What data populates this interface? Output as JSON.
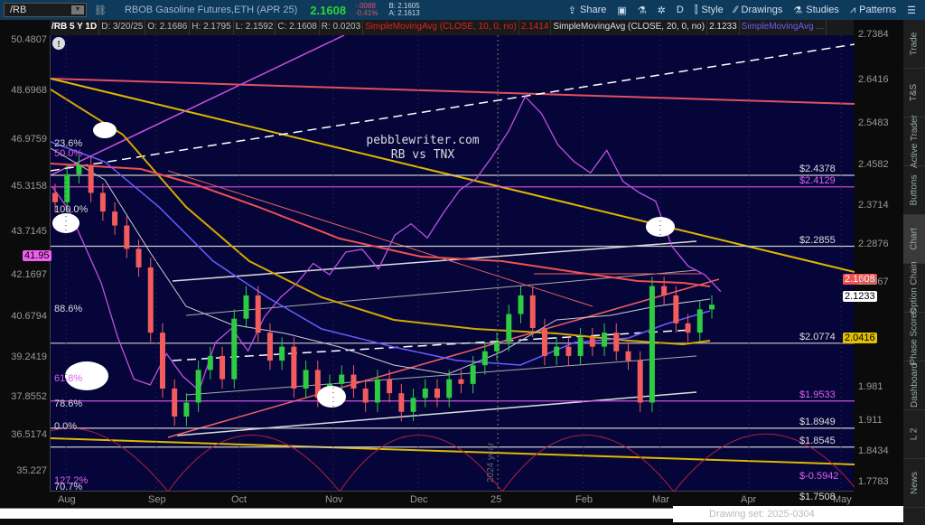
{
  "header": {
    "symbol": "/RB",
    "title": "RBOB Gasoline Futures,ETH (APR 25)",
    "last": "2.1608",
    "change": "-.0088",
    "change_pct": "-0.41%",
    "bid": "B: 2.1605",
    "ask": "A: 2.1613",
    "buttons": [
      "Share",
      "D",
      "Style",
      "Drawings",
      "Studies",
      "Patterns"
    ]
  },
  "info": {
    "label": "/RB 5 Y 1D",
    "date": "D: 3/20/25",
    "open": "O: 2.1686",
    "high": "H: 2.1795",
    "low": "L: 2.1592",
    "close": "C: 2.1608",
    "range": "R: 0.0203",
    "sma10": "SimpleMovingAvg (CLOSE, 10, 0, no)",
    "sma10_val": "2.1414",
    "sma20": "SimpleMovingAvg (CLOSE, 20, 0, no)",
    "sma20_val": "2.1233",
    "sma_other": "SimpleMovingAvg ..."
  },
  "sidebar": [
    "Trade",
    "T&S",
    "Active Trader",
    "Buttons",
    "Chart",
    "Option Chain",
    "Phase Scores",
    "Dashboard",
    "L 2",
    "News"
  ],
  "status": "Drawing set: 2025-0304",
  "colors": {
    "bg": "#05053a",
    "up": "#2ecc40",
    "down": "#f25c5c",
    "tnx": "#c050e0",
    "sma_red": "#e03030",
    "sma_gold": "#d4a800"
  },
  "chart_data": {
    "type": "candlestick",
    "title": "pebblewriter.com",
    "subtitle": "RB vs TNX",
    "x_ticks": [
      "Aug",
      "Sep",
      "Oct",
      "Nov",
      "Dec",
      "25",
      "Feb",
      "Mar",
      "Apr",
      "May"
    ],
    "divider_label": "2024 year",
    "right_axis": {
      "ticks": [
        "2.7384",
        "2.6416",
        "2.5483",
        "2.4582",
        "2.3714",
        "2.2876",
        "2.2067",
        "1.981",
        "1.911",
        "1.8434",
        "1.7783"
      ],
      "range": [
        1.7783,
        2.7384
      ]
    },
    "left_axis": {
      "ticks": [
        "50.4807",
        "48.6968",
        "46.9759",
        "45.3158",
        "43.7145",
        "42.1697",
        "40.6794",
        "39.2419",
        "37.8552",
        "36.5174",
        "35.227"
      ],
      "range": [
        35.227,
        50.4807
      ]
    },
    "rb_closes": [
      2.38,
      2.44,
      2.46,
      2.4,
      2.36,
      2.33,
      2.28,
      2.24,
      2.1,
      1.98,
      1.92,
      1.95,
      2.02,
      2.05,
      2.0,
      2.13,
      2.18,
      2.1,
      2.04,
      2.07,
      1.98,
      2.02,
      1.96,
      1.99,
      2.01,
      1.98,
      1.95,
      2.0,
      1.97,
      1.93,
      1.96,
      1.98,
      1.96,
      2.0,
      1.99,
      2.03,
      2.06,
      2.08,
      2.14,
      2.18,
      2.11,
      2.05,
      2.07,
      2.05,
      2.09,
      2.07,
      2.1,
      2.06,
      2.04,
      1.95,
      2.2,
      2.18,
      2.12,
      2.1,
      2.15,
      2.16
    ],
    "tnx_values": [
      45.3,
      44.5,
      43.2,
      41.9,
      40.0,
      38.5,
      38.3,
      39.4,
      38.6,
      38.1,
      39.8,
      40.3,
      39.5,
      40.7,
      41.4,
      41.9,
      42.6,
      42.2,
      43.0,
      43.1,
      42.4,
      43.6,
      44.0,
      43.5,
      44.4,
      45.2,
      45.6,
      46.4,
      47.3,
      48.5,
      47.9,
      46.8,
      46.2,
      45.8,
      46.6,
      45.5,
      45.1,
      44.8,
      43.2,
      42.5,
      42.2,
      41.6
    ],
    "price_tags": {
      "last": "2.1608",
      "sma20": "2.1233",
      "sma_gold": "2.0416",
      "tnx": "41.95"
    },
    "levels": [
      {
        "label": "$2.4378",
        "value": 2.4378
      },
      {
        "label": "$2.4129",
        "value": 2.4129,
        "color": "magenta"
      },
      {
        "label": "$2.2855",
        "value": 2.2855
      },
      {
        "label": "$2.0774",
        "value": 2.0774
      },
      {
        "label": "$1.9533",
        "value": 1.9533,
        "color": "magenta"
      },
      {
        "label": "$1.8949",
        "value": 1.8949
      },
      {
        "label": "$1.8545",
        "value": 1.8545
      },
      {
        "label": "$-0.5942",
        "value": 1.7783,
        "color": "magenta"
      },
      {
        "label": "$1.7508",
        "value": 1.7508
      }
    ],
    "fib_labels": [
      "23.6%",
      "50.0%",
      "100.0%",
      "88.6%",
      "61.8%",
      "78.6%",
      "0.0%",
      "127.2%",
      "70.7%"
    ]
  }
}
